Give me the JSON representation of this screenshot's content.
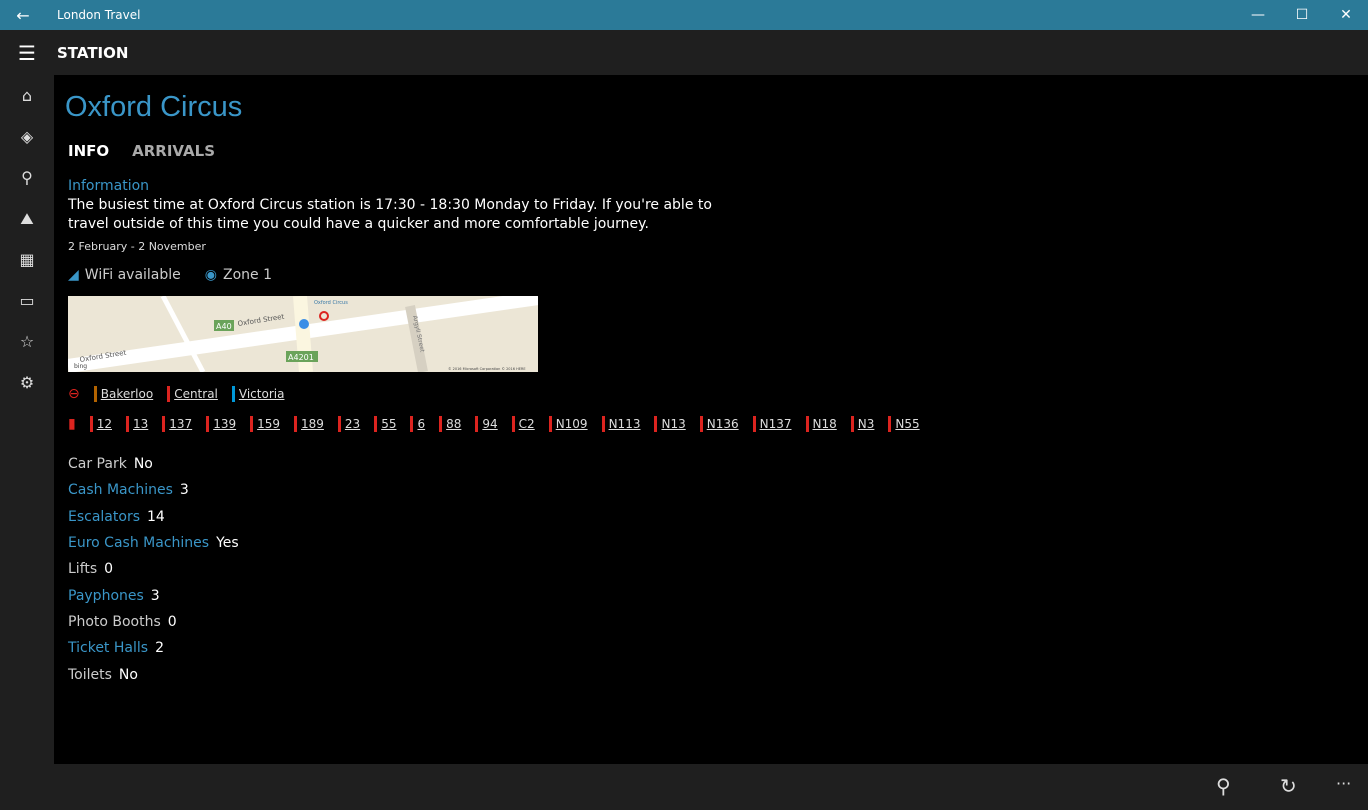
{
  "window": {
    "title": "London Travel",
    "back": "←",
    "minimize": "—",
    "maximize": "☐",
    "close": "✕"
  },
  "header": {
    "menu": "☰",
    "title": "STATION"
  },
  "sidebar": [
    {
      "name": "home-icon",
      "g": "⌂"
    },
    {
      "name": "directions-icon",
      "g": "◈"
    },
    {
      "name": "search-icon",
      "g": "⚲"
    },
    {
      "name": "walk-icon",
      "g": "⛰"
    },
    {
      "name": "map-icon",
      "g": "▦"
    },
    {
      "name": "message-icon",
      "g": "▭"
    },
    {
      "name": "favorites-icon",
      "g": "☆"
    },
    {
      "name": "settings-icon",
      "g": "⚙"
    }
  ],
  "page": {
    "title": "Oxford Circus",
    "tabs": [
      "INFO",
      "ARRIVALS"
    ]
  },
  "info": {
    "heading": "Information",
    "text": "The busiest time at Oxford Circus station is 17:30 - 18:30 Monday to Friday. If you're able to travel outside of this time you could have a quicker and more comfortable journey.",
    "dates": "2 February - 2 November"
  },
  "features": {
    "wifi": "WiFi available",
    "zone": "Zone 1"
  },
  "map": {
    "road1": "Oxford Street",
    "road2": "Oxford Street",
    "a40": "A40",
    "a4201": "A4201",
    "station": "Oxford Circus",
    "argyll": "Argyll Street",
    "copyright": "© 2016 Microsoft Corporation © 2016 HERE",
    "logo": "bing"
  },
  "tube_lines": [
    {
      "name": "Bakerloo",
      "color": "#b26300"
    },
    {
      "name": "Central",
      "color": "#dc241f"
    },
    {
      "name": "Victoria",
      "color": "#0098d8"
    }
  ],
  "bus_color": "#dc241f",
  "buses": [
    "12",
    "13",
    "137",
    "139",
    "159",
    "189",
    "23",
    "55",
    "6",
    "88",
    "94",
    "C2",
    "N109",
    "N113",
    "N13",
    "N136",
    "N137",
    "N18",
    "N3",
    "N55"
  ],
  "facts": [
    {
      "k": "Car Park",
      "v": "No",
      "link": false
    },
    {
      "k": "Cash Machines",
      "v": "3",
      "link": true
    },
    {
      "k": "Escalators",
      "v": "14",
      "link": true
    },
    {
      "k": "Euro Cash Machines",
      "v": "Yes",
      "link": true
    },
    {
      "k": "Lifts",
      "v": "0",
      "link": false
    },
    {
      "k": "Payphones",
      "v": "3",
      "link": true
    },
    {
      "k": "Photo Booths",
      "v": "0",
      "link": false
    },
    {
      "k": "Ticket Halls",
      "v": "2",
      "link": true
    },
    {
      "k": "Toilets",
      "v": "No",
      "link": false
    }
  ],
  "bottom": {
    "pin": "⚲",
    "refresh": "↻",
    "more": "···"
  }
}
